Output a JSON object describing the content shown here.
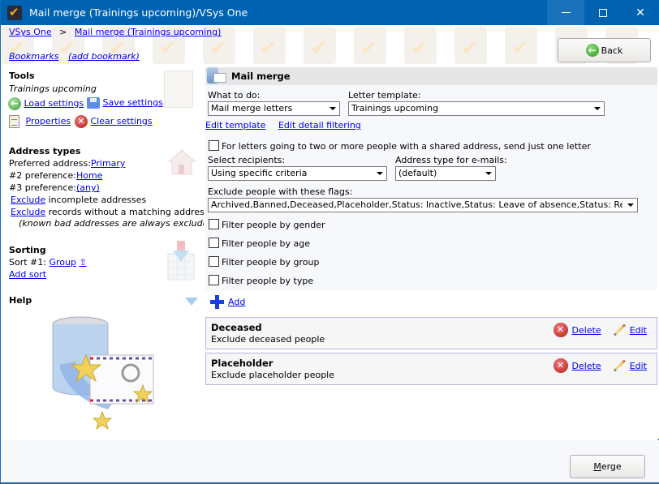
{
  "window": {
    "title": "Mail merge (Trainings upcoming)/VSys One",
    "controls": {
      "minimize": "minimize",
      "maximize": "maximize",
      "close": "close"
    }
  },
  "breadcrumb": {
    "items": [
      "VSys One",
      "Mail merge (Trainings upcoming)"
    ],
    "separator": ">"
  },
  "bookmarks": {
    "bookmarks_label": "Bookmarks",
    "add_label": "(add bookmark)"
  },
  "back_button": {
    "label": "Back"
  },
  "sidebar": {
    "tools": {
      "title": "Tools",
      "subtitle": "Trainings upcoming",
      "load_settings": "Load settings",
      "save_settings": "Save settings",
      "properties": "Properties",
      "clear_settings": "Clear settings"
    },
    "address_types": {
      "title": "Address types",
      "preferred_label": "Preferred address:",
      "preferred_value": "Primary",
      "pref2_label": "#2 preference:",
      "pref2_value": "Home",
      "pref3_label": "#3 preference:",
      "pref3_value": "(any)",
      "exclude1_link": "Exclude",
      "exclude1_text": "incomplete addresses",
      "exclude2_link": "Exclude",
      "exclude2_text": "records without a matching address",
      "note": "(known bad addresses are always excluded)"
    },
    "sorting": {
      "title": "Sorting",
      "sort1_label": "Sort #1:",
      "sort1_value": "Group",
      "sort1_dir": "⇧",
      "add_sort": "Add sort"
    },
    "help": {
      "title": "Help"
    }
  },
  "main": {
    "header": "Mail merge",
    "what_to_do": {
      "label": "What to do:",
      "value": "Mail merge letters"
    },
    "letter_template": {
      "label": "Letter template:",
      "value": "Trainings upcoming"
    },
    "edit_template": "Edit template",
    "edit_detail_filtering": "Edit detail filtering",
    "shared_address_checkbox": {
      "label": "For letters going to two or more people with a shared address, send just one letter",
      "checked": false
    },
    "select_recipients": {
      "label": "Select recipients:",
      "value": "Using specific criteria"
    },
    "address_type_emails": {
      "label": "Address type for e-mails:",
      "value": "(default)"
    },
    "exclude_flags": {
      "label": "Exclude people with these flags:",
      "value": "Archived,Banned,Deceased,Placeholder,Status: Inactive,Status: Leave of absence,Status: Rejected,Stat"
    },
    "filters": [
      {
        "label": "Filter people by gender",
        "checked": false
      },
      {
        "label": "Filter people by age",
        "checked": false
      },
      {
        "label": "Filter people by group",
        "checked": false
      },
      {
        "label": "Filter people by type",
        "checked": false
      }
    ],
    "add_label": "Add",
    "criteria": [
      {
        "name": "Deceased",
        "description": "Exclude deceased people",
        "delete": "Delete",
        "edit": "Edit"
      },
      {
        "name": "Placeholder",
        "description": "Exclude placeholder people",
        "delete": "Delete",
        "edit": "Edit"
      }
    ]
  },
  "footer": {
    "merge_button": "Merge",
    "merge_mnemonic": "M",
    "merge_rest": "erge"
  },
  "colors": {
    "titlebar": "#0063b1",
    "link": "#0000ee",
    "panel_header": "#e6e6e6",
    "criteria_border": "#b5b9e6"
  }
}
